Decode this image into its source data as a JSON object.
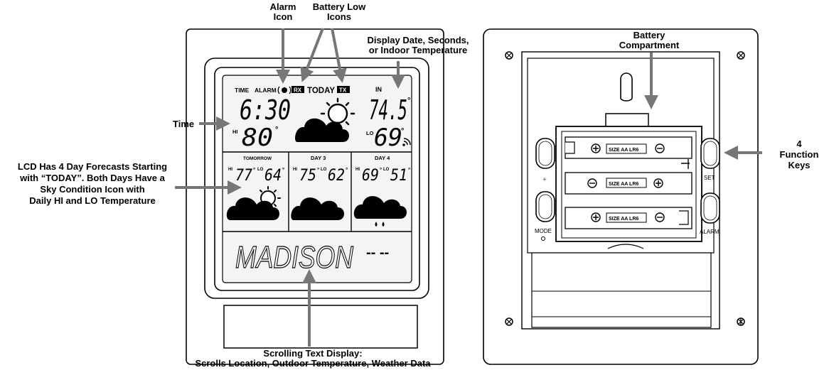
{
  "callouts": {
    "alarm_icon": [
      "Alarm",
      "Icon"
    ],
    "battery_low": [
      "Battery Low",
      "Icons"
    ],
    "display_date": [
      "Display Date, Seconds,",
      "or Indoor Temperature"
    ],
    "time": "Time",
    "lcd_forecast": [
      "LCD Has 4 Day Forecasts Starting",
      "with “TODAY”. Both Days Have a",
      "Sky Condition Icon with",
      "Daily HI and LO Temperature"
    ],
    "scrolling": [
      "Scrolling Text Display:",
      "Scrolls Location, Outdoor Temperature, Weather Data"
    ],
    "battery_compartment": [
      "Battery",
      "Compartment"
    ],
    "function_keys": [
      "4",
      "Function",
      "Keys"
    ]
  },
  "lcd": {
    "top_labels": {
      "time": "TIME",
      "alarm": "ALARM",
      "rx": "RX",
      "today": "TODAY",
      "tx": "TX",
      "in": "IN"
    },
    "time_value": "6:30",
    "hi_label": "HI",
    "today_hi": "80",
    "indoor_temp": "74.5",
    "lo_label": "LO",
    "today_lo": "69",
    "degree": "°",
    "forecast_days": [
      {
        "label": "TOMORROW",
        "hi": "77",
        "lo": "64",
        "icon": "partly-cloudy"
      },
      {
        "label": "DAY 3",
        "hi": "75",
        "lo": "62",
        "icon": "cloudy"
      },
      {
        "label": "DAY 4",
        "hi": "69",
        "lo": "51",
        "icon": "rain"
      }
    ],
    "scroll_text": "MADISON",
    "scroll_suffix": "-- --"
  },
  "back": {
    "battery_label": "SIZE  AA  LR6",
    "buttons": {
      "plus": "+",
      "mode": "MODE",
      "set": "SET",
      "alarm": "ALARM"
    }
  }
}
